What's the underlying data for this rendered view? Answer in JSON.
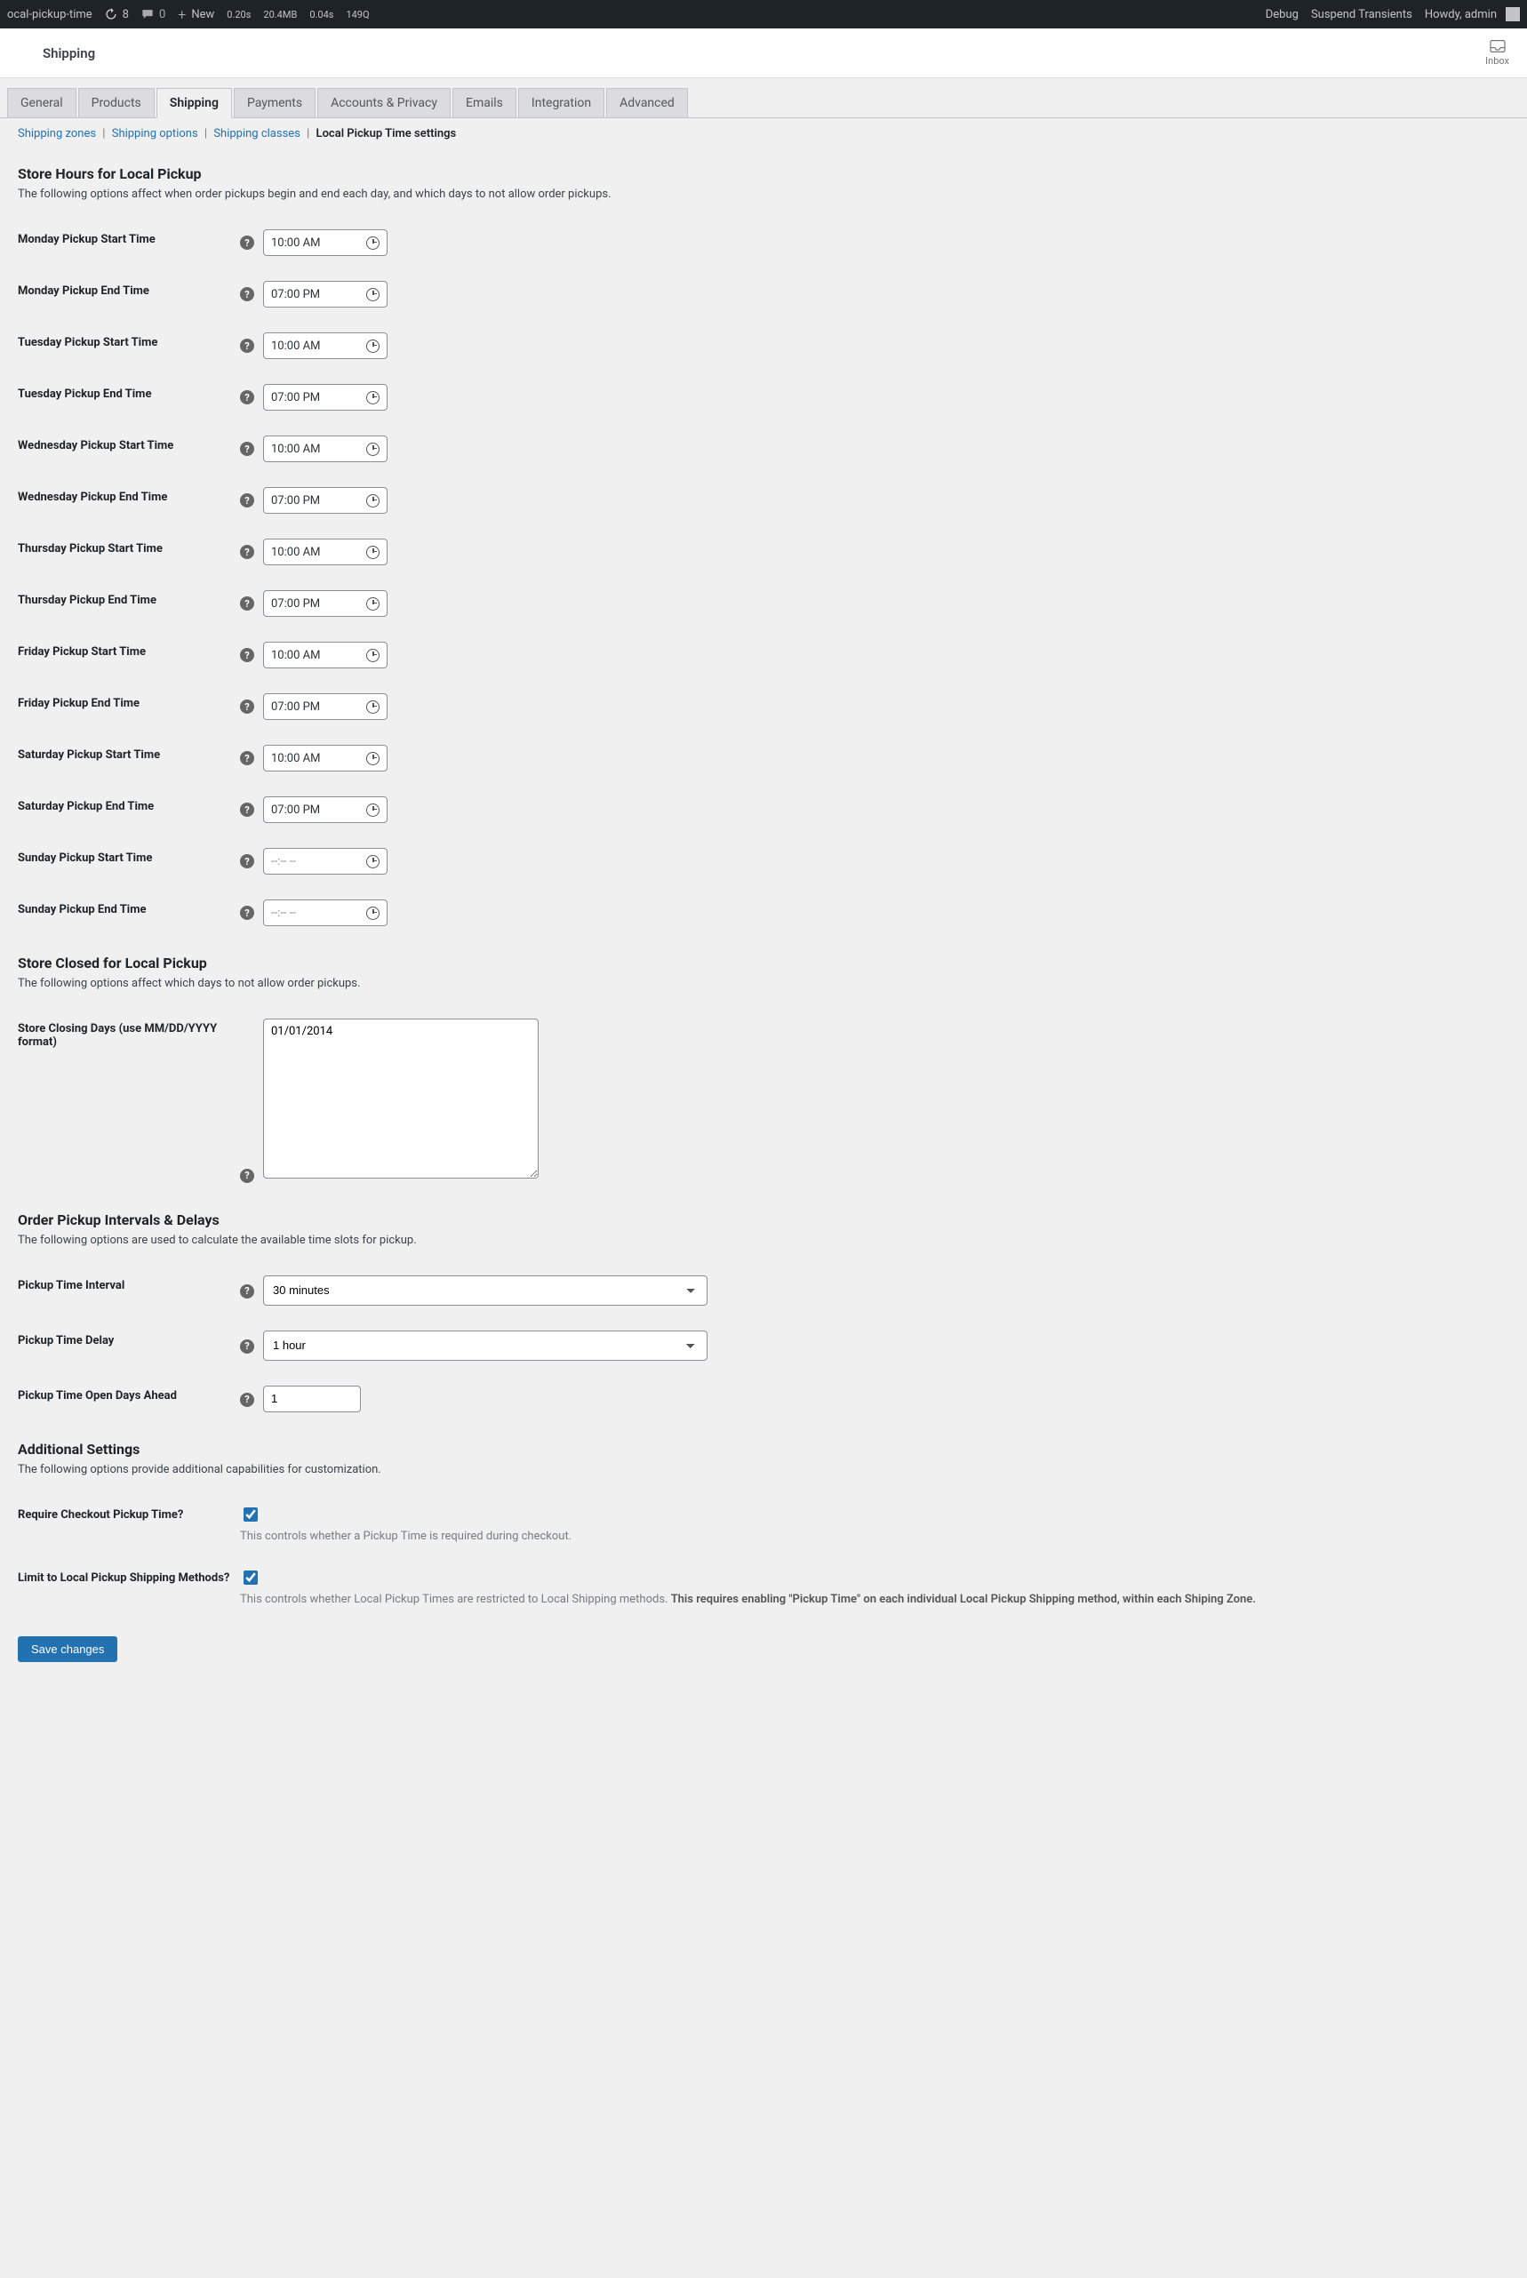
{
  "adminbar": {
    "site": "ocal-pickup-time",
    "updates": "8",
    "comments": "0",
    "new": "New",
    "t1": "0.20s",
    "mem": "20.4MB",
    "t2": "0.04s",
    "q": "149Q",
    "debug": "Debug",
    "suspend": "Suspend Transients",
    "howdy": "Howdy, admin"
  },
  "header": {
    "title": "Shipping",
    "inbox": "Inbox"
  },
  "tabs": [
    "General",
    "Products",
    "Shipping",
    "Payments",
    "Accounts & Privacy",
    "Emails",
    "Integration",
    "Advanced"
  ],
  "active_tab_index": 2,
  "subnav": {
    "zones": "Shipping zones",
    "options": "Shipping options",
    "classes": "Shipping classes",
    "current": "Local Pickup Time settings"
  },
  "sections": {
    "hours_title": "Store Hours for Local Pickup",
    "hours_desc": "The following options affect when order pickups begin and end each day, and which days to not allow order pickups.",
    "closed_title": "Store Closed for Local Pickup",
    "closed_desc": "The following options affect which days to not allow order pickups.",
    "intervals_title": "Order Pickup Intervals & Delays",
    "intervals_desc": "The following options are used to calculate the available time slots for pickup.",
    "additional_title": "Additional Settings",
    "additional_desc": "The following options provide additional capabilities for customization."
  },
  "fields": {
    "mon_start": {
      "label": "Monday Pickup Start Time",
      "value": "10:00 AM"
    },
    "mon_end": {
      "label": "Monday Pickup End Time",
      "value": "07:00 PM"
    },
    "tue_start": {
      "label": "Tuesday Pickup Start Time",
      "value": "10:00 AM"
    },
    "tue_end": {
      "label": "Tuesday Pickup End Time",
      "value": "07:00 PM"
    },
    "wed_start": {
      "label": "Wednesday Pickup Start Time",
      "value": "10:00 AM"
    },
    "wed_end": {
      "label": "Wednesday Pickup End Time",
      "value": "07:00 PM"
    },
    "thu_start": {
      "label": "Thursday Pickup Start Time",
      "value": "10:00 AM"
    },
    "thu_end": {
      "label": "Thursday Pickup End Time",
      "value": "07:00 PM"
    },
    "fri_start": {
      "label": "Friday Pickup Start Time",
      "value": "10:00 AM"
    },
    "fri_end": {
      "label": "Friday Pickup End Time",
      "value": "07:00 PM"
    },
    "sat_start": {
      "label": "Saturday Pickup Start Time",
      "value": "10:00 AM"
    },
    "sat_end": {
      "label": "Saturday Pickup End Time",
      "value": "07:00 PM"
    },
    "sun_start": {
      "label": "Sunday Pickup Start Time",
      "value": "--:-- --"
    },
    "sun_end": {
      "label": "Sunday Pickup End Time",
      "value": "--:-- --"
    },
    "closing_days": {
      "label": "Store Closing Days (use MM/DD/YYYY format)",
      "value": "01/01/2014"
    },
    "interval": {
      "label": "Pickup Time Interval",
      "value": "30 minutes"
    },
    "delay": {
      "label": "Pickup Time Delay",
      "value": "1 hour"
    },
    "days_ahead": {
      "label": "Pickup Time Open Days Ahead",
      "value": "1"
    },
    "require_checkout": {
      "label": "Require Checkout Pickup Time?",
      "desc": "This controls whether a Pickup Time is required during checkout."
    },
    "limit_local": {
      "label": "Limit to Local Pickup Shipping Methods?",
      "desc1": "This controls whether Local Pickup Times are restricted to Local Shipping methods. ",
      "desc2": "This requires enabling \"Pickup Time\" on each individual Local Pickup Shipping method, within each Shiping Zone."
    }
  },
  "save": "Save changes"
}
